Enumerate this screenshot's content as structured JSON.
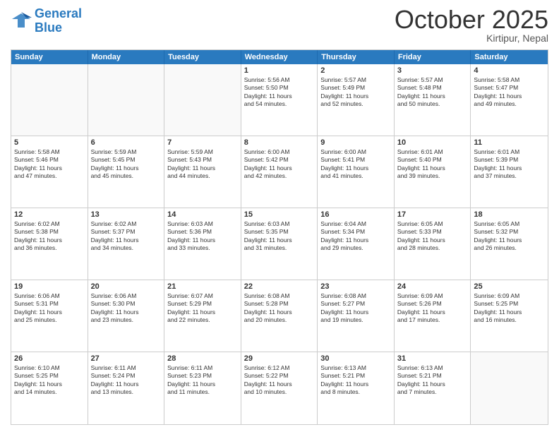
{
  "logo": {
    "line1": "General",
    "line2": "Blue"
  },
  "title": "October 2025",
  "location": "Kirtipur, Nepal",
  "days": [
    "Sunday",
    "Monday",
    "Tuesday",
    "Wednesday",
    "Thursday",
    "Friday",
    "Saturday"
  ],
  "weeks": [
    [
      {
        "day": "",
        "info": ""
      },
      {
        "day": "",
        "info": ""
      },
      {
        "day": "",
        "info": ""
      },
      {
        "day": "1",
        "info": "Sunrise: 5:56 AM\nSunset: 5:50 PM\nDaylight: 11 hours\nand 54 minutes."
      },
      {
        "day": "2",
        "info": "Sunrise: 5:57 AM\nSunset: 5:49 PM\nDaylight: 11 hours\nand 52 minutes."
      },
      {
        "day": "3",
        "info": "Sunrise: 5:57 AM\nSunset: 5:48 PM\nDaylight: 11 hours\nand 50 minutes."
      },
      {
        "day": "4",
        "info": "Sunrise: 5:58 AM\nSunset: 5:47 PM\nDaylight: 11 hours\nand 49 minutes."
      }
    ],
    [
      {
        "day": "5",
        "info": "Sunrise: 5:58 AM\nSunset: 5:46 PM\nDaylight: 11 hours\nand 47 minutes."
      },
      {
        "day": "6",
        "info": "Sunrise: 5:59 AM\nSunset: 5:45 PM\nDaylight: 11 hours\nand 45 minutes."
      },
      {
        "day": "7",
        "info": "Sunrise: 5:59 AM\nSunset: 5:43 PM\nDaylight: 11 hours\nand 44 minutes."
      },
      {
        "day": "8",
        "info": "Sunrise: 6:00 AM\nSunset: 5:42 PM\nDaylight: 11 hours\nand 42 minutes."
      },
      {
        "day": "9",
        "info": "Sunrise: 6:00 AM\nSunset: 5:41 PM\nDaylight: 11 hours\nand 41 minutes."
      },
      {
        "day": "10",
        "info": "Sunrise: 6:01 AM\nSunset: 5:40 PM\nDaylight: 11 hours\nand 39 minutes."
      },
      {
        "day": "11",
        "info": "Sunrise: 6:01 AM\nSunset: 5:39 PM\nDaylight: 11 hours\nand 37 minutes."
      }
    ],
    [
      {
        "day": "12",
        "info": "Sunrise: 6:02 AM\nSunset: 5:38 PM\nDaylight: 11 hours\nand 36 minutes."
      },
      {
        "day": "13",
        "info": "Sunrise: 6:02 AM\nSunset: 5:37 PM\nDaylight: 11 hours\nand 34 minutes."
      },
      {
        "day": "14",
        "info": "Sunrise: 6:03 AM\nSunset: 5:36 PM\nDaylight: 11 hours\nand 33 minutes."
      },
      {
        "day": "15",
        "info": "Sunrise: 6:03 AM\nSunset: 5:35 PM\nDaylight: 11 hours\nand 31 minutes."
      },
      {
        "day": "16",
        "info": "Sunrise: 6:04 AM\nSunset: 5:34 PM\nDaylight: 11 hours\nand 29 minutes."
      },
      {
        "day": "17",
        "info": "Sunrise: 6:05 AM\nSunset: 5:33 PM\nDaylight: 11 hours\nand 28 minutes."
      },
      {
        "day": "18",
        "info": "Sunrise: 6:05 AM\nSunset: 5:32 PM\nDaylight: 11 hours\nand 26 minutes."
      }
    ],
    [
      {
        "day": "19",
        "info": "Sunrise: 6:06 AM\nSunset: 5:31 PM\nDaylight: 11 hours\nand 25 minutes."
      },
      {
        "day": "20",
        "info": "Sunrise: 6:06 AM\nSunset: 5:30 PM\nDaylight: 11 hours\nand 23 minutes."
      },
      {
        "day": "21",
        "info": "Sunrise: 6:07 AM\nSunset: 5:29 PM\nDaylight: 11 hours\nand 22 minutes."
      },
      {
        "day": "22",
        "info": "Sunrise: 6:08 AM\nSunset: 5:28 PM\nDaylight: 11 hours\nand 20 minutes."
      },
      {
        "day": "23",
        "info": "Sunrise: 6:08 AM\nSunset: 5:27 PM\nDaylight: 11 hours\nand 19 minutes."
      },
      {
        "day": "24",
        "info": "Sunrise: 6:09 AM\nSunset: 5:26 PM\nDaylight: 11 hours\nand 17 minutes."
      },
      {
        "day": "25",
        "info": "Sunrise: 6:09 AM\nSunset: 5:25 PM\nDaylight: 11 hours\nand 16 minutes."
      }
    ],
    [
      {
        "day": "26",
        "info": "Sunrise: 6:10 AM\nSunset: 5:25 PM\nDaylight: 11 hours\nand 14 minutes."
      },
      {
        "day": "27",
        "info": "Sunrise: 6:11 AM\nSunset: 5:24 PM\nDaylight: 11 hours\nand 13 minutes."
      },
      {
        "day": "28",
        "info": "Sunrise: 6:11 AM\nSunset: 5:23 PM\nDaylight: 11 hours\nand 11 minutes."
      },
      {
        "day": "29",
        "info": "Sunrise: 6:12 AM\nSunset: 5:22 PM\nDaylight: 11 hours\nand 10 minutes."
      },
      {
        "day": "30",
        "info": "Sunrise: 6:13 AM\nSunset: 5:21 PM\nDaylight: 11 hours\nand 8 minutes."
      },
      {
        "day": "31",
        "info": "Sunrise: 6:13 AM\nSunset: 5:21 PM\nDaylight: 11 hours\nand 7 minutes."
      },
      {
        "day": "",
        "info": ""
      }
    ]
  ]
}
